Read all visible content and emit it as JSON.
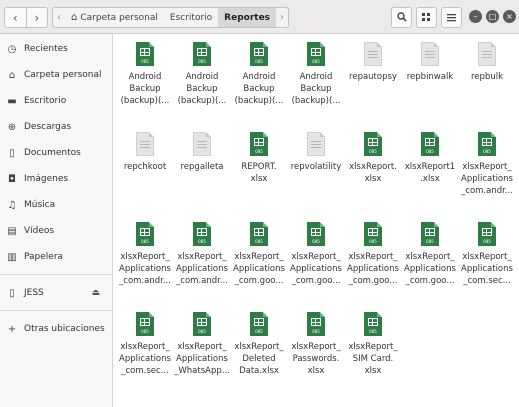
{
  "header": {
    "nav_back": "‹",
    "nav_forward": "›",
    "path_left_arrow": "‹",
    "path_right_arrow": "›",
    "path": [
      "Carpeta personal",
      "Escritorio",
      "Reportes"
    ],
    "search_icon": "search-icon",
    "view_icon": "grid-view-icon",
    "menu_icon": "hamburger-menu-icon"
  },
  "sidebar": {
    "items": [
      {
        "icon": "clock-icon",
        "label": "Recientes"
      },
      {
        "icon": "home-icon",
        "label": "Carpeta personal"
      },
      {
        "icon": "desktop-icon",
        "label": "Escritorio"
      },
      {
        "icon": "download-icon",
        "label": "Descargas"
      },
      {
        "icon": "document-icon",
        "label": "Documentos"
      },
      {
        "icon": "camera-icon",
        "label": "Imágenes"
      },
      {
        "icon": "music-icon",
        "label": "Música"
      },
      {
        "icon": "video-icon",
        "label": "Vídeos"
      },
      {
        "icon": "trash-icon",
        "label": "Papelera"
      }
    ],
    "device": {
      "icon": "usb-drive-icon",
      "label": "JESS",
      "eject": "⏏"
    },
    "other": {
      "icon": "plus-icon",
      "label": "Otras ubicaciones"
    }
  },
  "files": [
    {
      "name": "Android\nBackup\n(backup)(...",
      "type": "xlsx"
    },
    {
      "name": "Android\nBackup\n(backup)(...",
      "type": "xlsx"
    },
    {
      "name": "Android\nBackup\n(backup)(...",
      "type": "xlsx"
    },
    {
      "name": "Android\nBackup\n(backup)(...",
      "type": "xlsx"
    },
    {
      "name": "repautopsy",
      "type": "generic"
    },
    {
      "name": "repbinwalk",
      "type": "generic"
    },
    {
      "name": "repbulk",
      "type": "generic"
    },
    {
      "name": "repchkoot",
      "type": "generic"
    },
    {
      "name": "repgalleta",
      "type": "generic"
    },
    {
      "name": "REPORT.\nxlsx",
      "type": "xlsx"
    },
    {
      "name": "repvolatility",
      "type": "generic"
    },
    {
      "name": "xlsxReport.\nxlsx",
      "type": "xlsx"
    },
    {
      "name": "xlsxReport1\n.xlsx",
      "type": "xlsx"
    },
    {
      "name": "xlsxReport_\nApplications\n_com.andr...",
      "type": "xlsx"
    },
    {
      "name": "xlsxReport_\nApplications\n_com.andr...",
      "type": "xlsx"
    },
    {
      "name": "xlsxReport_\nApplications\n_com.andr...",
      "type": "xlsx"
    },
    {
      "name": "xlsxReport_\nApplications\n_com.goo...",
      "type": "xlsx"
    },
    {
      "name": "xlsxReport_\nApplications\n_com.goo...",
      "type": "xlsx"
    },
    {
      "name": "xlsxReport_\nApplications\n_com.goo...",
      "type": "xlsx"
    },
    {
      "name": "xlsxReport_\nApplications\n_com.goo...",
      "type": "xlsx"
    },
    {
      "name": "xlsxReport_\nApplications\n_com.sec...",
      "type": "xlsx"
    },
    {
      "name": "xlsxReport_\nApplications\n_com.sec...",
      "type": "xlsx"
    },
    {
      "name": "xlsxReport_\nApplications\n_WhatsApp...",
      "type": "xlsx"
    },
    {
      "name": "xlsxReport_\nDeleted\nData.xlsx",
      "type": "xlsx"
    },
    {
      "name": "xlsxReport_\nPasswords.\nxlsx",
      "type": "xlsx"
    },
    {
      "name": "xlsxReport_\nSIM Card.\nxlsx",
      "type": "xlsx"
    }
  ],
  "xlsx_tag": "085"
}
